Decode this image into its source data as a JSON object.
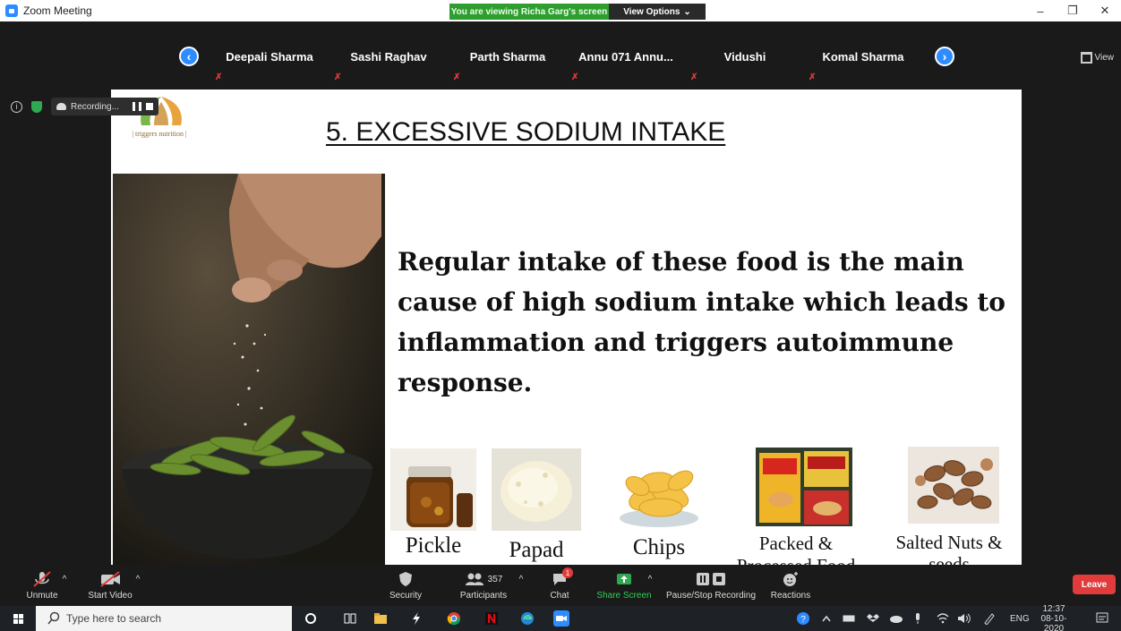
{
  "window": {
    "title": "Zoom Meeting"
  },
  "banner": {
    "viewing": "You are viewing Richa Garg's screen",
    "view_options": "View Options",
    "caret": "⌄"
  },
  "window_controls": {
    "minimize": "–",
    "maximize": "❐",
    "close": "✕"
  },
  "view_button": {
    "label": "View"
  },
  "participants": [
    {
      "name": "Deepali Sharma"
    },
    {
      "name": "Sashi Raghav"
    },
    {
      "name": "Parth Sharma"
    },
    {
      "name": "Annu 071 Annu..."
    },
    {
      "name": "Vidushi"
    },
    {
      "name": "Komal Sharma"
    }
  ],
  "arrows": {
    "prev": "‹",
    "next": "›"
  },
  "recording": {
    "label": "Recording...",
    "info_glyph": "i"
  },
  "slide": {
    "logo_text": "| triggers nutrition |",
    "title": "5. EXCESSIVE SODIUM INTAKE",
    "body": "Regular intake of these food is the main cause of high sodium intake which leads to inflammation and triggers autoimmune response.",
    "foods": [
      {
        "label": "Pickle"
      },
      {
        "label": "Papad"
      },
      {
        "label": "Chips"
      },
      {
        "label": "Packed &\nProcessed Food"
      },
      {
        "label": "Salted Nuts &\nseeds"
      }
    ]
  },
  "toolbar": {
    "unmute": "Unmute",
    "start_video": "Start Video",
    "security": "Security",
    "participants": "Participants",
    "participant_count": "357",
    "chat": "Chat",
    "chat_badge": "1",
    "share_screen": "Share Screen",
    "pause_stop": "Pause/Stop Recording",
    "reactions": "Reactions",
    "leave": "Leave",
    "caret": "^"
  },
  "taskbar": {
    "search_placeholder": "Type here to search",
    "language": "ENG",
    "time": "12:37",
    "date": "08-10-2020"
  },
  "colors": {
    "zoom_blue": "#2d8cff",
    "share_green": "#2f9e2f",
    "leave_red": "#e23b3b",
    "mute_red": "#e23b3b"
  }
}
